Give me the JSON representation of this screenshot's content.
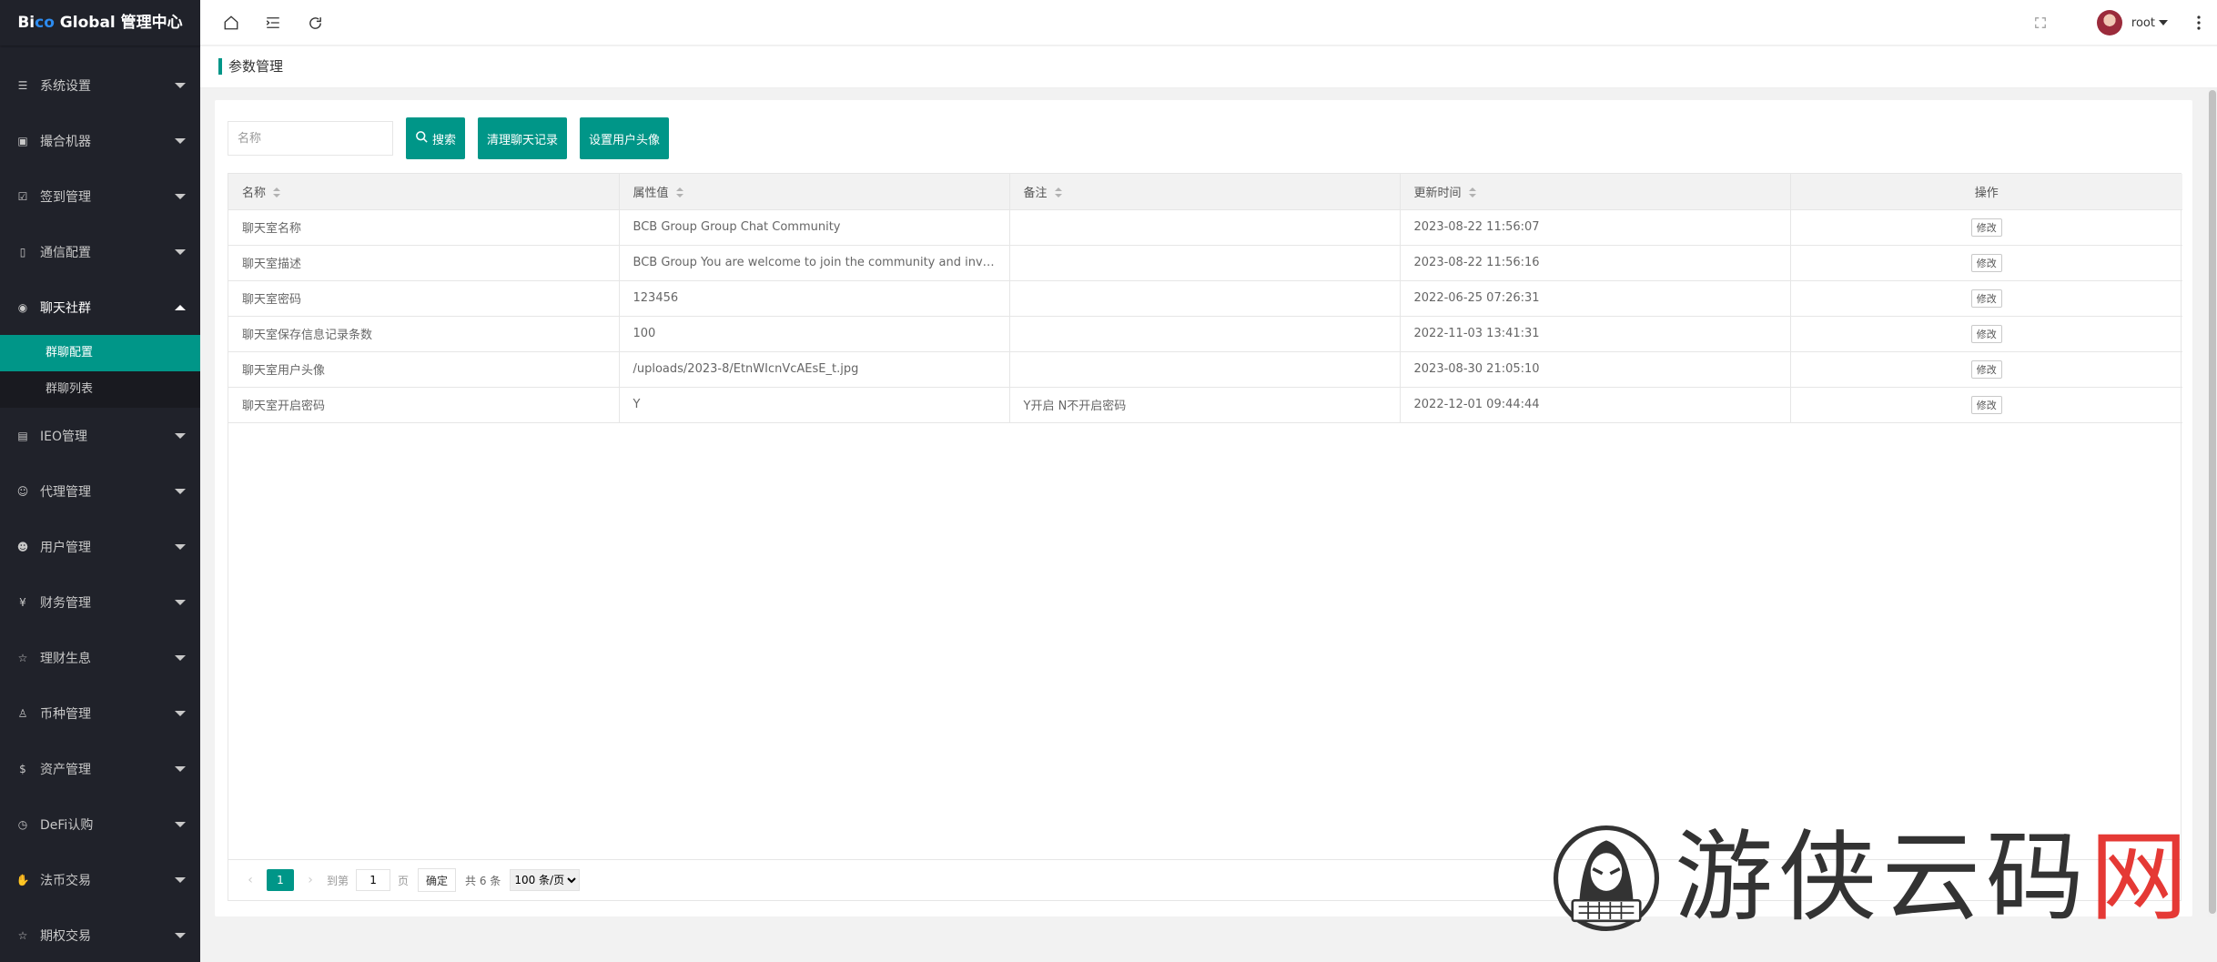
{
  "app": {
    "logo_prefix": "Bi",
    "logo_highlight": "co",
    "logo_suffix": " Global 管理中心"
  },
  "sidebar": {
    "items": [
      {
        "label": "系统设置",
        "icon": "sliders-icon",
        "glyph": "☰",
        "open": false
      },
      {
        "label": "撮合机器",
        "icon": "robot-icon",
        "glyph": "▣",
        "open": false
      },
      {
        "label": "签到管理",
        "icon": "checkin-icon",
        "glyph": "☑",
        "open": false
      },
      {
        "label": "通信配置",
        "icon": "phone-icon",
        "glyph": "▯",
        "open": false
      },
      {
        "label": "聊天社群",
        "icon": "chat-icon",
        "glyph": "◉",
        "open": true
      },
      {
        "label": "IEO管理",
        "icon": "ieo-icon",
        "glyph": "▤",
        "open": false
      },
      {
        "label": "代理管理",
        "icon": "user-icon",
        "glyph": "☺",
        "open": false
      },
      {
        "label": "用户管理",
        "icon": "users-icon",
        "glyph": "☻",
        "open": false
      },
      {
        "label": "财务管理",
        "icon": "yen-icon",
        "glyph": "¥",
        "open": false
      },
      {
        "label": "理财生息",
        "icon": "star-icon",
        "glyph": "☆",
        "open": false
      },
      {
        "label": "币种管理",
        "icon": "coins-icon",
        "glyph": "♙",
        "open": false
      },
      {
        "label": "资产管理",
        "icon": "dollar-icon",
        "glyph": "$",
        "open": false
      },
      {
        "label": "DeFi认购",
        "icon": "clock-icon",
        "glyph": "◷",
        "open": false
      },
      {
        "label": "法币交易",
        "icon": "hand-icon",
        "glyph": "✋",
        "open": false
      },
      {
        "label": "期权交易",
        "icon": "star-outline-icon",
        "glyph": "☆",
        "open": false
      }
    ],
    "submenu": [
      {
        "label": "群聊配置",
        "active": true
      },
      {
        "label": "群聊列表",
        "active": false
      }
    ]
  },
  "header": {
    "username": "root"
  },
  "page": {
    "title": "参数管理"
  },
  "toolbar": {
    "search_placeholder": "名称",
    "search_label": "搜索",
    "clear_label": "清理聊天记录",
    "avatar_label": "设置用户头像"
  },
  "table": {
    "columns": [
      "名称",
      "属性值",
      "备注",
      "更新时间",
      "操作"
    ],
    "rows": [
      {
        "name": "聊天室名称",
        "value": "BCB Group Group Chat Community",
        "note": "",
        "time": "2023-08-22 11:56:07",
        "action": "修改"
      },
      {
        "name": "聊天室描述",
        "value": "BCB Group You are welcome to join the community and invite…",
        "note": "",
        "time": "2023-08-22 11:56:16",
        "action": "修改"
      },
      {
        "name": "聊天室密码",
        "value": "123456",
        "note": "",
        "time": "2022-06-25 07:26:31",
        "action": "修改"
      },
      {
        "name": "聊天室保存信息记录条数",
        "value": "100",
        "note": "",
        "time": "2022-11-03 13:41:31",
        "action": "修改"
      },
      {
        "name": "聊天室用户头像",
        "value": "/uploads/2023-8/EtnWIcnVcAEsE_t.jpg",
        "note": "",
        "time": "2023-08-30 21:05:10",
        "action": "修改"
      },
      {
        "name": "聊天室开启密码",
        "value": "Y",
        "note": "Y开启 N不开启密码",
        "time": "2022-12-01 09:44:44",
        "action": "修改"
      }
    ]
  },
  "pager": {
    "current": "1",
    "goto_label": "到第",
    "page_input": "1",
    "page_unit": "页",
    "ok_label": "确定",
    "total": "共 6 条",
    "per_page": "100 条/页"
  },
  "watermark": {
    "text_main": "游侠云码",
    "text_red": "网"
  }
}
